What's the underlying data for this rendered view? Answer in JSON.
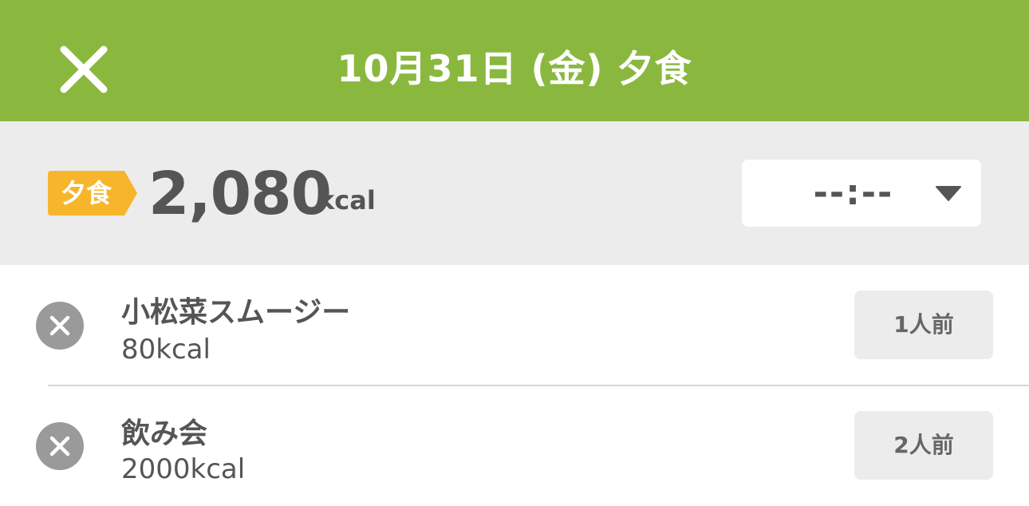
{
  "header": {
    "title": "10月31日 (金) 夕食",
    "close_icon": "close-icon",
    "background_color": "#8ab83f"
  },
  "summary": {
    "meal_badge": "夕食",
    "badge_color": "#f7b52c",
    "total_kcal": "2,080",
    "unit": "kcal",
    "time_value": "--:--",
    "dropdown_icon": "caret-down-icon"
  },
  "items": [
    {
      "name": "小松菜スムージー",
      "kcal": "80kcal",
      "serving": "1人前",
      "remove_icon": "remove-circle-icon"
    },
    {
      "name": "飲み会",
      "kcal": "2000kcal",
      "serving": "2人前",
      "remove_icon": "remove-circle-icon"
    }
  ]
}
